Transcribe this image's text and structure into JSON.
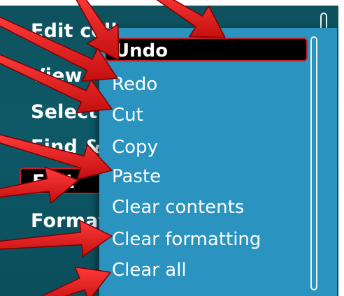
{
  "background_menu": {
    "items": [
      {
        "label": "Edit cell"
      },
      {
        "label": "View"
      },
      {
        "label": "Select"
      },
      {
        "label": "Find &"
      },
      {
        "label": "Edit",
        "highlighted": true
      },
      {
        "label": "Format"
      }
    ]
  },
  "submenu": {
    "items": [
      {
        "label": "Undo",
        "selected": true
      },
      {
        "label": "Redo"
      },
      {
        "label": "Cut"
      },
      {
        "label": "Copy"
      },
      {
        "label": "Paste"
      },
      {
        "label": "Clear contents"
      },
      {
        "label": "Clear formatting"
      },
      {
        "label": "Clear all"
      }
    ]
  },
  "annotation": {
    "arrow_count": 8,
    "arrow_color": "#e41b1b"
  },
  "colors": {
    "screen_bg": "#0d5665",
    "submenu_bg": "#2a93bf",
    "highlight_bg": "#000000",
    "highlight_border": "#c8202a",
    "text": "#ffffff"
  }
}
